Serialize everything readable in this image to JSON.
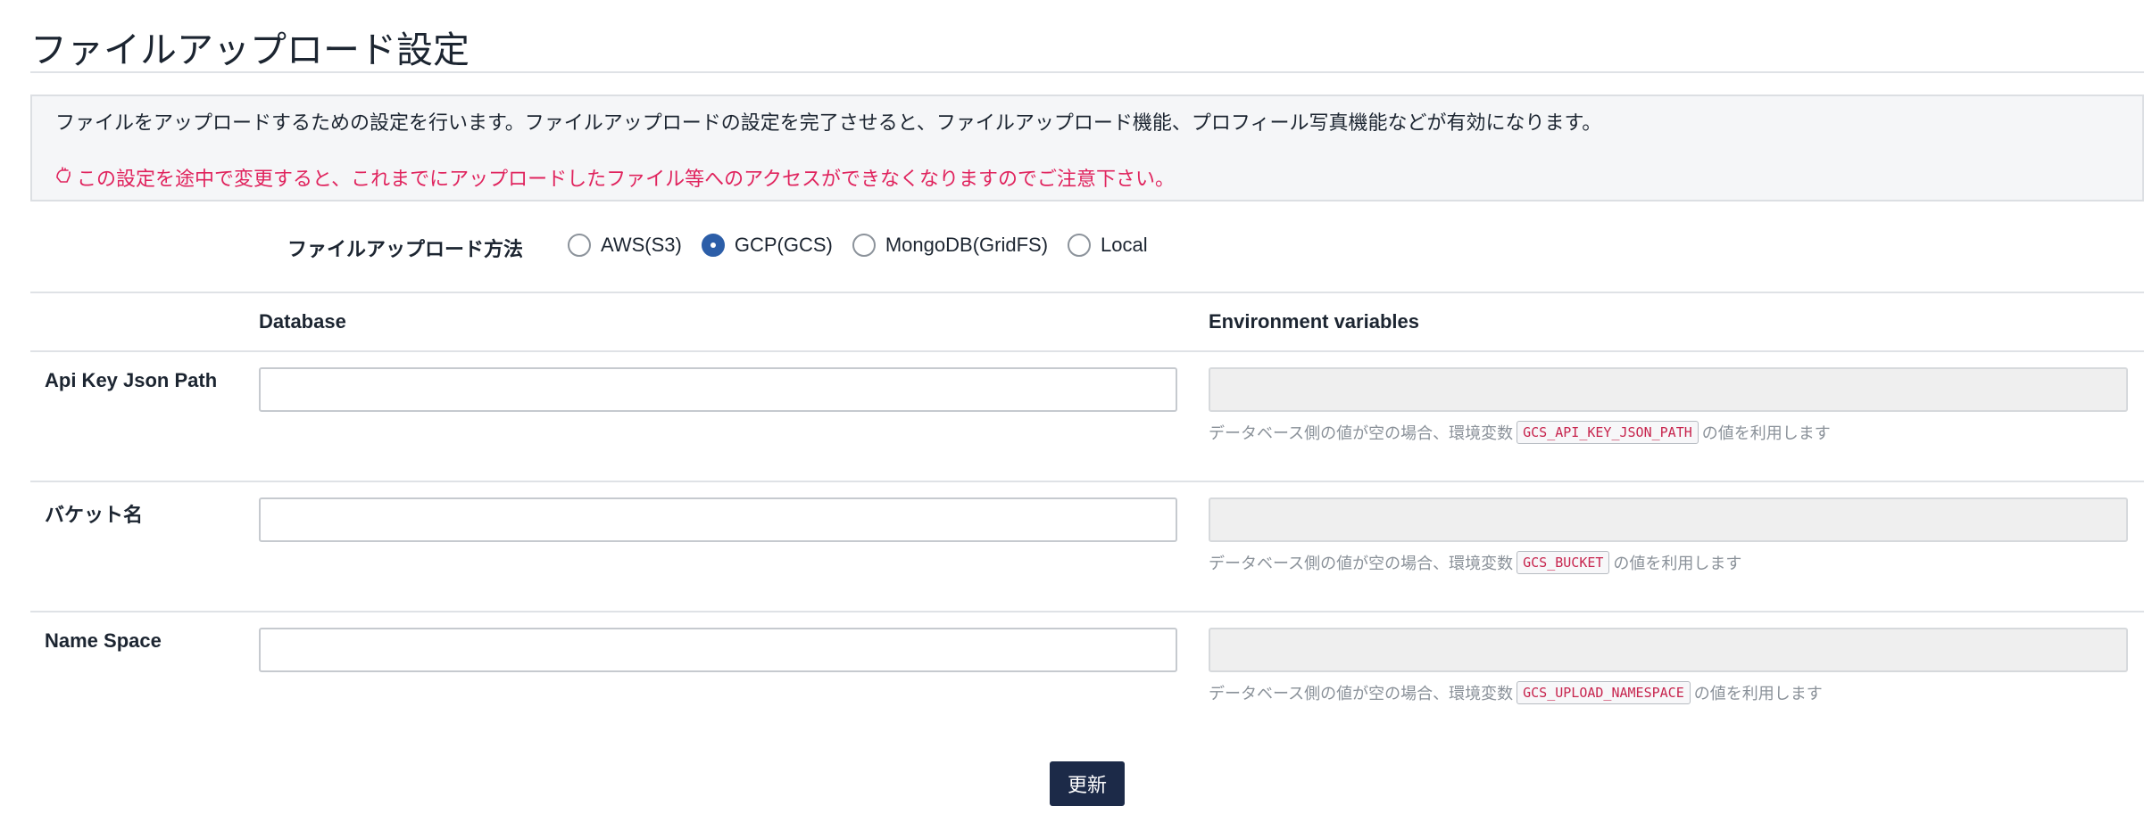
{
  "page": {
    "title": "ファイルアップロード設定"
  },
  "info": {
    "description": "ファイルをアップロードするための設定を行います。ファイルアップロードの設定を完了させると、ファイルアップロード機能、プロフィール写真機能などが有効になります。",
    "warning": "この設定を途中で変更すると、これまでにアップロードしたファイル等へのアクセスができなくなりますのでご注意下さい。",
    "warning_color": "#e0245e"
  },
  "upload_method": {
    "label": "ファイルアップロード方法",
    "selected": "GCP(GCS)",
    "options": [
      "AWS(S3)",
      "GCP(GCS)",
      "MongoDB(GridFS)",
      "Local"
    ]
  },
  "table": {
    "col_database": "Database",
    "col_env": "Environment variables",
    "help_prefix": "データベース側の値が空の場合、環境変数",
    "help_suffix": "の値を利用します",
    "rows": [
      {
        "label": "Api Key Json Path",
        "db_value": "",
        "env_value": "",
        "env_var": "GCS_API_KEY_JSON_PATH"
      },
      {
        "label": "バケット名",
        "db_value": "",
        "env_value": "",
        "env_var": "GCS_BUCKET"
      },
      {
        "label": "Name Space",
        "db_value": "",
        "env_value": "",
        "env_var": "GCS_UPLOAD_NAMESPACE"
      }
    ]
  },
  "actions": {
    "submit_label": "更新",
    "submit_color": "#1c2a48"
  },
  "colors": {
    "radio_checked": "#2c5ea8",
    "code_text": "#c7254e"
  }
}
